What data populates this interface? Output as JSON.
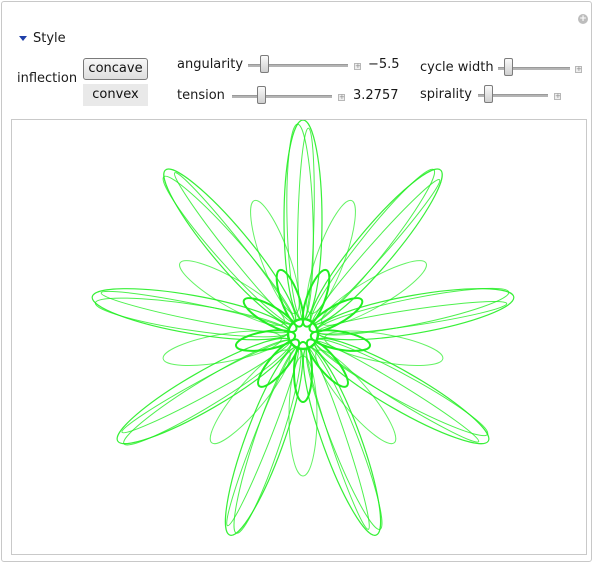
{
  "style_section": {
    "label": "Style"
  },
  "inflection": {
    "label": "inflection",
    "options": [
      "concave",
      "convex"
    ],
    "selected": "concave"
  },
  "sliders": {
    "angularity": {
      "label": "angularity",
      "value": "−5.5"
    },
    "tension": {
      "label": "tension",
      "value": "3.2757"
    },
    "cycle_width": {
      "label": "cycle width"
    },
    "spirality": {
      "label": "spirality"
    }
  },
  "figure": {
    "stroke_color": "#22ee22",
    "petals": 9
  }
}
